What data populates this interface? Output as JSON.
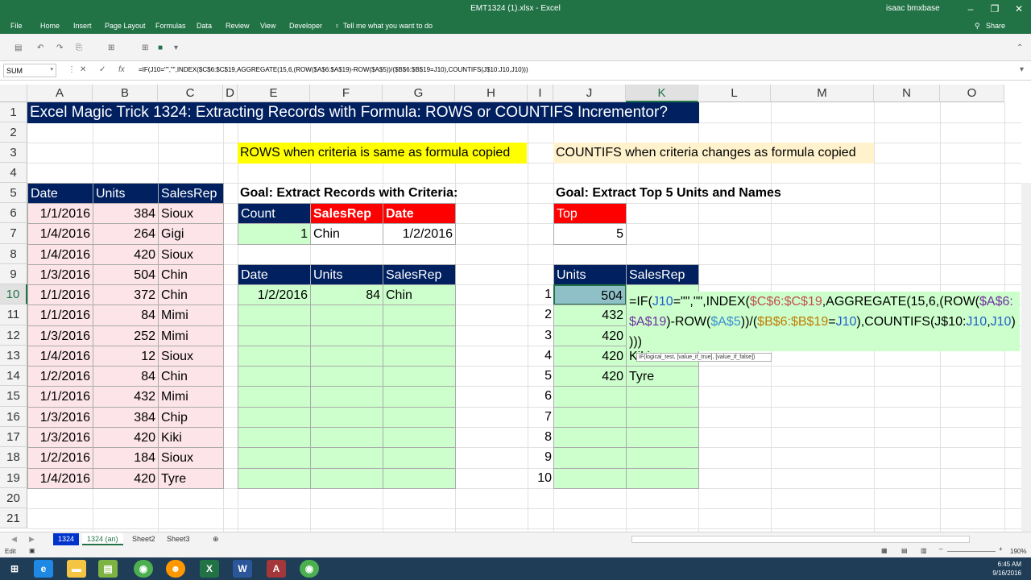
{
  "window": {
    "title": "EMT1324 (1).xlsx - Excel",
    "user": "isaac bmxbase",
    "share": "Share"
  },
  "ribbon": [
    "File",
    "Home",
    "Insert",
    "Page Layout",
    "Formulas",
    "Data",
    "Review",
    "View",
    "Developer",
    "Tell me what you want to do"
  ],
  "namebox": "SUM",
  "formula": "=IF(J10=\"\",\"\",INDEX($C$6:$C$19,AGGREGATE(15,6,(ROW($A$6:$A$19)-ROW($A$5))/($B$6:$B$19=J10),COUNTIFS(J$10:J10,J10)))",
  "columns": [
    "A",
    "B",
    "C",
    "D",
    "E",
    "F",
    "G",
    "H",
    "I",
    "J",
    "K",
    "L",
    "M",
    "N",
    "O"
  ],
  "rows": [
    "1",
    "2",
    "3",
    "4",
    "5",
    "6",
    "7",
    "8",
    "9",
    "10",
    "11",
    "12",
    "13",
    "14",
    "15",
    "16",
    "17",
    "18",
    "19",
    "20",
    "21"
  ],
  "title": "Excel Magic Trick 1324: Extracting Records with Formula: ROWS or COUNTIFS Incrementor?",
  "labels": {
    "rows_note": "ROWS when criteria is same as formula copied",
    "countifs_note": "COUNTIFS when criteria changes as formula copied",
    "goal1": "Goal: Extract Records with Criteria:",
    "goal2": "Goal: Extract Top 5 Units and Names"
  },
  "source": {
    "headers": [
      "Date",
      "Units",
      "SalesRep"
    ],
    "rows": [
      [
        "1/1/2016",
        "384",
        "Sioux"
      ],
      [
        "1/4/2016",
        "264",
        "Gigi"
      ],
      [
        "1/4/2016",
        "420",
        "Sioux"
      ],
      [
        "1/3/2016",
        "504",
        "Chin"
      ],
      [
        "1/1/2016",
        "372",
        "Chin"
      ],
      [
        "1/1/2016",
        "84",
        "Mimi"
      ],
      [
        "1/3/2016",
        "252",
        "Mimi"
      ],
      [
        "1/4/2016",
        "12",
        "Sioux"
      ],
      [
        "1/2/2016",
        "84",
        "Chin"
      ],
      [
        "1/1/2016",
        "432",
        "Mimi"
      ],
      [
        "1/3/2016",
        "384",
        "Chip"
      ],
      [
        "1/3/2016",
        "420",
        "Kiki"
      ],
      [
        "1/2/2016",
        "184",
        "Sioux"
      ],
      [
        "1/4/2016",
        "420",
        "Tyre"
      ]
    ]
  },
  "criteria": {
    "headers": [
      "Count",
      "SalesRep",
      "Date"
    ],
    "values": [
      "1",
      "Chin",
      "1/2/2016"
    ]
  },
  "extract": {
    "headers": [
      "Date",
      "Units",
      "SalesRep"
    ],
    "row1": [
      "1/2/2016",
      "84",
      "Chin"
    ]
  },
  "top": {
    "header": "Top",
    "value": "5"
  },
  "topn": {
    "headers": [
      "Units",
      "SalesRep"
    ],
    "nums": [
      "1",
      "2",
      "3",
      "4",
      "5",
      "6",
      "7",
      "8",
      "9",
      "10"
    ],
    "units": [
      "504",
      "432",
      "420",
      "420",
      "420"
    ],
    "reps": [
      "Kiki",
      "Tyre"
    ]
  },
  "edit": {
    "line1": "=IF(J10=\"\",\"\",INDEX($C$6:$C$19,AGGREGATE(15,6,(ROW($A$6:",
    "line2": "$A$19)-ROW($A$5))/($B$6:$B$19=J10),COUNTIFS(J$10:J10,J10)",
    "line3": ")))"
  },
  "tooltip": "IF(logical_test, [value_if_true], [value_if_false])",
  "sheets": [
    "1324",
    "1324 (an)",
    "Sheet2",
    "Sheet3"
  ],
  "status": {
    "mode": "Edit",
    "zoom": "190%"
  },
  "clock": {
    "time": "6:45 AM",
    "date": "9/16/2016"
  },
  "colors": {
    "excel_green": "#217346",
    "navy": "#002060",
    "red": "#ff0000",
    "yellow": "#ffff00",
    "green_fill": "#ccffcc",
    "pink_fill": "#fce4e9"
  }
}
